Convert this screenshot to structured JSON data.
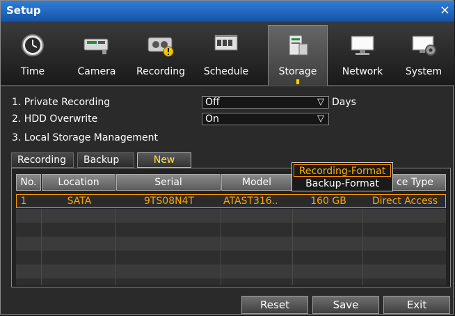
{
  "window": {
    "title": "Setup",
    "close_glyph": "×"
  },
  "tabs": [
    {
      "label": "Time",
      "icon": "clock-icon"
    },
    {
      "label": "Camera",
      "icon": "camera-icon"
    },
    {
      "label": "Recording",
      "icon": "recorder-icon"
    },
    {
      "label": "Schedule",
      "icon": "calendar-icon"
    },
    {
      "label": "Storage",
      "icon": "storage-icon",
      "active": true
    },
    {
      "label": "Network",
      "icon": "monitor-icon"
    },
    {
      "label": "System",
      "icon": "system-gear-icon"
    }
  ],
  "settings": {
    "private_recording": {
      "label": "1. Private Recording",
      "value": "Off",
      "suffix": "Days"
    },
    "hdd_overwrite": {
      "label": "2. HDD Overwrite",
      "value": "On"
    },
    "local_storage": {
      "label": "3. Local Storage Management"
    }
  },
  "subtabs": [
    "Recording",
    "Backup",
    "New"
  ],
  "table": {
    "columns": [
      "No.",
      "Location",
      "Serial",
      "Model",
      "",
      "ce Type"
    ],
    "rows": [
      [
        "1",
        "SATA",
        "9TS08N4T",
        "ATAST316..",
        "160 GB",
        "Direct Access"
      ]
    ]
  },
  "menu": {
    "items": [
      "Recording-Format",
      "Backup-Format"
    ]
  },
  "buttons": {
    "reset": "Reset",
    "save": "Save",
    "exit": "Exit"
  },
  "colors": {
    "accent": "#ffa500",
    "titlebar": "#1f68c4",
    "active_subtab_text": "#ffe34a"
  }
}
